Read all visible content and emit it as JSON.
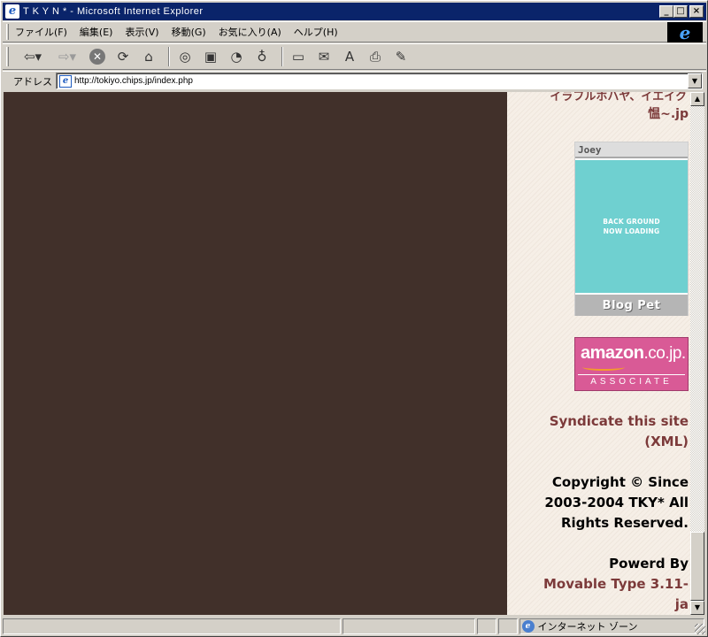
{
  "window": {
    "title": "T K Y N * - Microsoft Internet Explorer",
    "min_label": "_",
    "max_label": "□",
    "close_label": "×"
  },
  "menu": {
    "items": [
      "ファイル(F)",
      "編集(E)",
      "表示(V)",
      "移動(G)",
      "お気に入り(A)",
      "ヘルプ(H)"
    ]
  },
  "toolbar": {
    "icons": [
      "back-icon",
      "forward-icon",
      "stop-icon",
      "refresh-icon",
      "home-icon",
      "search-icon",
      "favorites-icon",
      "history-icon",
      "channels-icon",
      "fullscreen-icon",
      "mail-icon",
      "font-icon",
      "print-icon",
      "edit-icon"
    ],
    "font_glyph": "A"
  },
  "address": {
    "label": "アドレス",
    "url": "http://tokiyo.chips.jp/index.php"
  },
  "sidebar": {
    "cut_text": "イラフルホハヤ、イエイク",
    "link_jp": "愠~.jp",
    "blogpet": {
      "header": "Joey",
      "line1": "BACK GROUND",
      "line2": "NOW LOADING",
      "footer": "Blog Pet"
    },
    "amazon": {
      "logo": "amazon",
      "logo_suffix": ".co.jp.",
      "associate": "ASSOCIATE"
    },
    "syndicate_line1": "Syndicate this site",
    "syndicate_line2": "(XML)",
    "copyright_line1": "Copyright © Since",
    "copyright_line2": "2003-2004 TKY* All",
    "copyright_line3": "Rights Reserved.",
    "powered_by": "Powerd By",
    "mt_line1": "Movable Type 3.11-",
    "mt_line2": "ja"
  },
  "status": {
    "zone": "インターネット ゾーン"
  },
  "colors": {
    "content_dark": "#41302a",
    "sidebar_bg": "#f4ece3",
    "link": "#7c3a3a",
    "title_bar": "#0a246a"
  }
}
